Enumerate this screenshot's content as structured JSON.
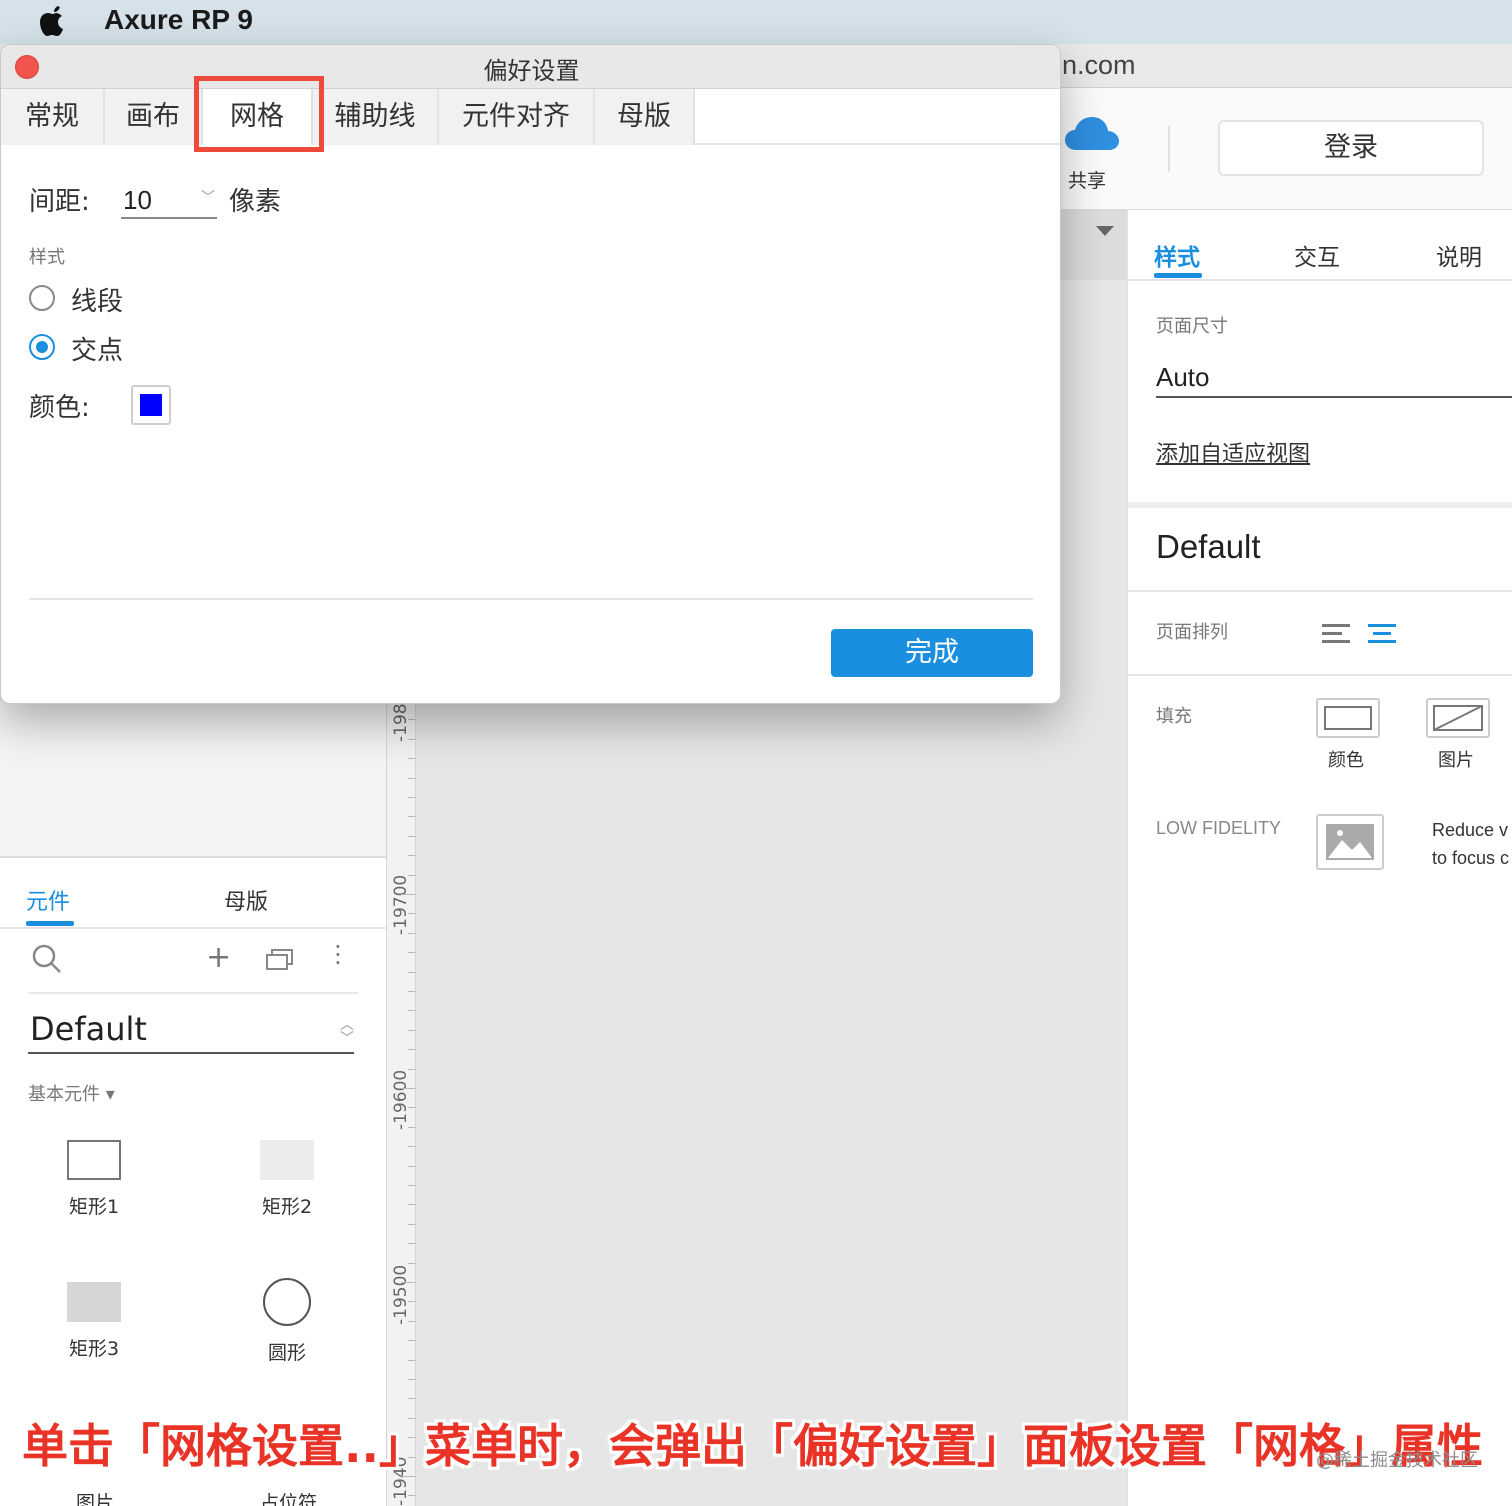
{
  "menubar": {
    "apple_icon": "apple-logo-icon",
    "app_name": "Axure RP 9"
  },
  "window": {
    "title_fragment": "n.com",
    "share_label": "共享",
    "login_label": "登录"
  },
  "dialog": {
    "title": "偏好设置",
    "tabs": [
      {
        "label": "常规",
        "active": false
      },
      {
        "label": "画布",
        "active": false
      },
      {
        "label": "网格",
        "active": true
      },
      {
        "label": "辅助线",
        "active": false
      },
      {
        "label": "元件对齐",
        "active": false
      },
      {
        "label": "母版",
        "active": false
      }
    ],
    "spacing_label": "间距:",
    "spacing_value": "10",
    "spacing_unit": "像素",
    "style_label": "样式",
    "style_options": [
      {
        "label": "线段",
        "checked": false
      },
      {
        "label": "交点",
        "checked": true
      }
    ],
    "color_label": "颜色:",
    "grid_color": "#0000ff",
    "done_label": "完成"
  },
  "ruler": {
    "labels": [
      "-198",
      "-19700",
      "-19600",
      "-19500",
      "-1940"
    ]
  },
  "left_panel": {
    "tabs": [
      {
        "label": "元件",
        "active": true
      },
      {
        "label": "母版",
        "active": false
      }
    ],
    "library": "Default",
    "section": "基本元件 ▾",
    "widgets": [
      "矩形1",
      "矩形2",
      "矩形3",
      "圆形"
    ],
    "bottom_widgets": [
      "图片",
      "占位符"
    ]
  },
  "right_panel": {
    "tabs": [
      {
        "label": "样式",
        "active": true
      },
      {
        "label": "交互",
        "active": false
      },
      {
        "label": "说明",
        "active": false
      }
    ],
    "page_size_label": "页面尺寸",
    "page_size_value": "Auto",
    "adaptive_link": "添加自适应视图",
    "style_name": "Default",
    "page_align_label": "页面排列",
    "fill_label": "填充",
    "fill_color_label": "颜色",
    "fill_image_label": "图片",
    "low_fidelity_label": "LOW FIDELITY",
    "low_fidelity_desc": "Reduce v\nto focus c"
  },
  "caption": "单击「网格设置..」菜单时，会弹出「偏好设置」面板设置「网格」属性",
  "watermark": "@稀土掘金技术社区",
  "colors": {
    "accent": "#1a8fe0",
    "highlight": "#ee4a3c",
    "close": "#f0544c"
  }
}
